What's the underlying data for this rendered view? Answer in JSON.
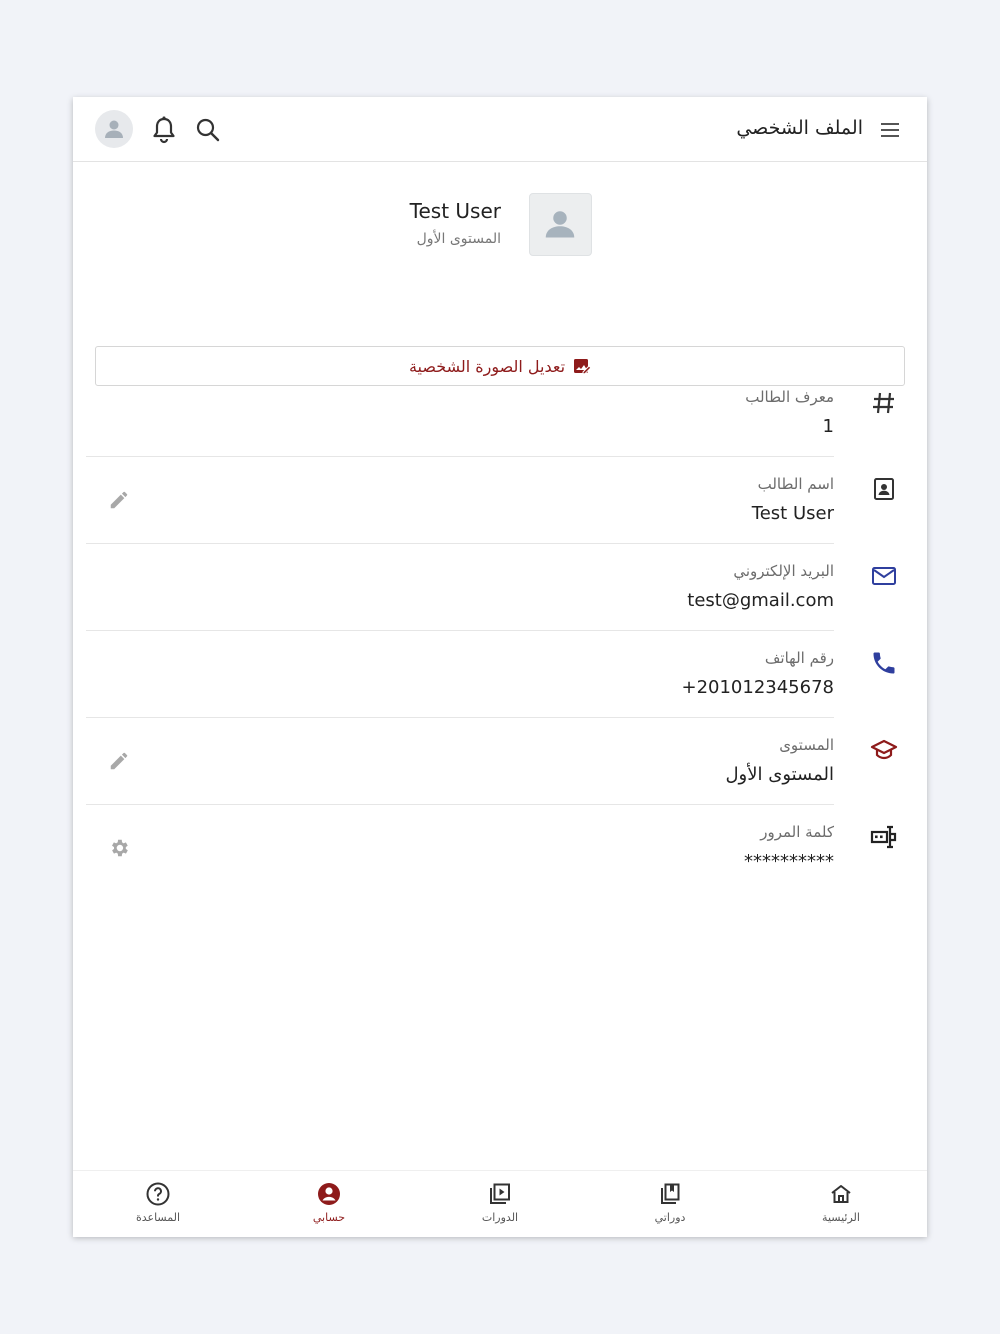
{
  "header": {
    "title": "الملف الشخصي",
    "icons": [
      "menu-icon",
      "search-icon",
      "bell-icon",
      "avatar-icon"
    ]
  },
  "profile": {
    "name": "Test User",
    "level": "المستوى الأول",
    "edit_photo_label": "تعديل الصورة الشخصية"
  },
  "fields": [
    {
      "label": "معرف الطالب",
      "value": "1",
      "icon": "hash-icon",
      "action": null
    },
    {
      "label": "اسم الطالب",
      "value": "Test User",
      "icon": "contact-card-icon",
      "action": "edit-icon"
    },
    {
      "label": "البريد الإلكتروني",
      "value": "test@gmail.com",
      "icon": "mail-icon",
      "action": null
    },
    {
      "label": "رقم الهاتف",
      "value": "+201012345678",
      "icon": "phone-icon",
      "action": null
    },
    {
      "label": "المستوى",
      "value": "المستوى الأول",
      "icon": "graduation-cap-icon",
      "action": "edit-icon"
    },
    {
      "label": "كلمة المرور",
      "value": "**********",
      "icon": "password-icon",
      "action": "gear-icon"
    }
  ],
  "bottom_nav": [
    {
      "label": "الرئيسية",
      "icon": "home-icon",
      "active": false
    },
    {
      "label": "دوراتي",
      "icon": "my-courses-icon",
      "active": false
    },
    {
      "label": "الدورات",
      "icon": "courses-icon",
      "active": false
    },
    {
      "label": "حسابي",
      "icon": "account-icon",
      "active": true
    },
    {
      "label": "المساعدة",
      "icon": "help-icon",
      "active": false
    }
  ],
  "colors": {
    "accent": "#8e1b1b",
    "icon_blue": "#2f3f9e",
    "background": "#f1f3f8"
  }
}
